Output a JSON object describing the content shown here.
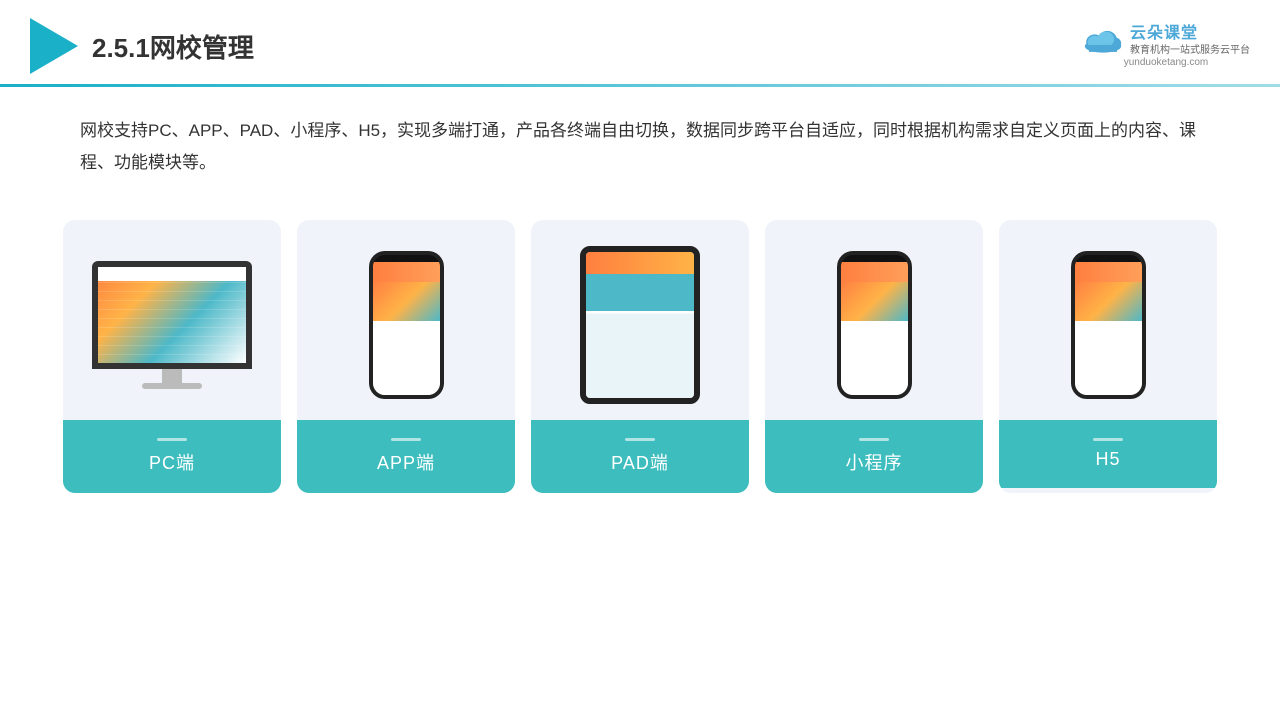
{
  "header": {
    "title": "2.5.1网校管理",
    "brand": {
      "name": "云朵课堂",
      "url": "yunduoketang.com",
      "tagline": "教育机构一站式服务云平台"
    }
  },
  "description": "网校支持PC、APP、PAD、小程序、H5，实现多端打通，产品各终端自由切换，数据同步跨平台自适应，同时根据机构需求自定义页面上的内容、课程、功能模块等。",
  "cards": [
    {
      "id": "pc",
      "label": "PC端",
      "type": "pc"
    },
    {
      "id": "app",
      "label": "APP端",
      "type": "phone"
    },
    {
      "id": "pad",
      "label": "PAD端",
      "type": "tablet"
    },
    {
      "id": "miniapp",
      "label": "小程序",
      "type": "phone"
    },
    {
      "id": "h5",
      "label": "H5",
      "type": "phone"
    }
  ]
}
